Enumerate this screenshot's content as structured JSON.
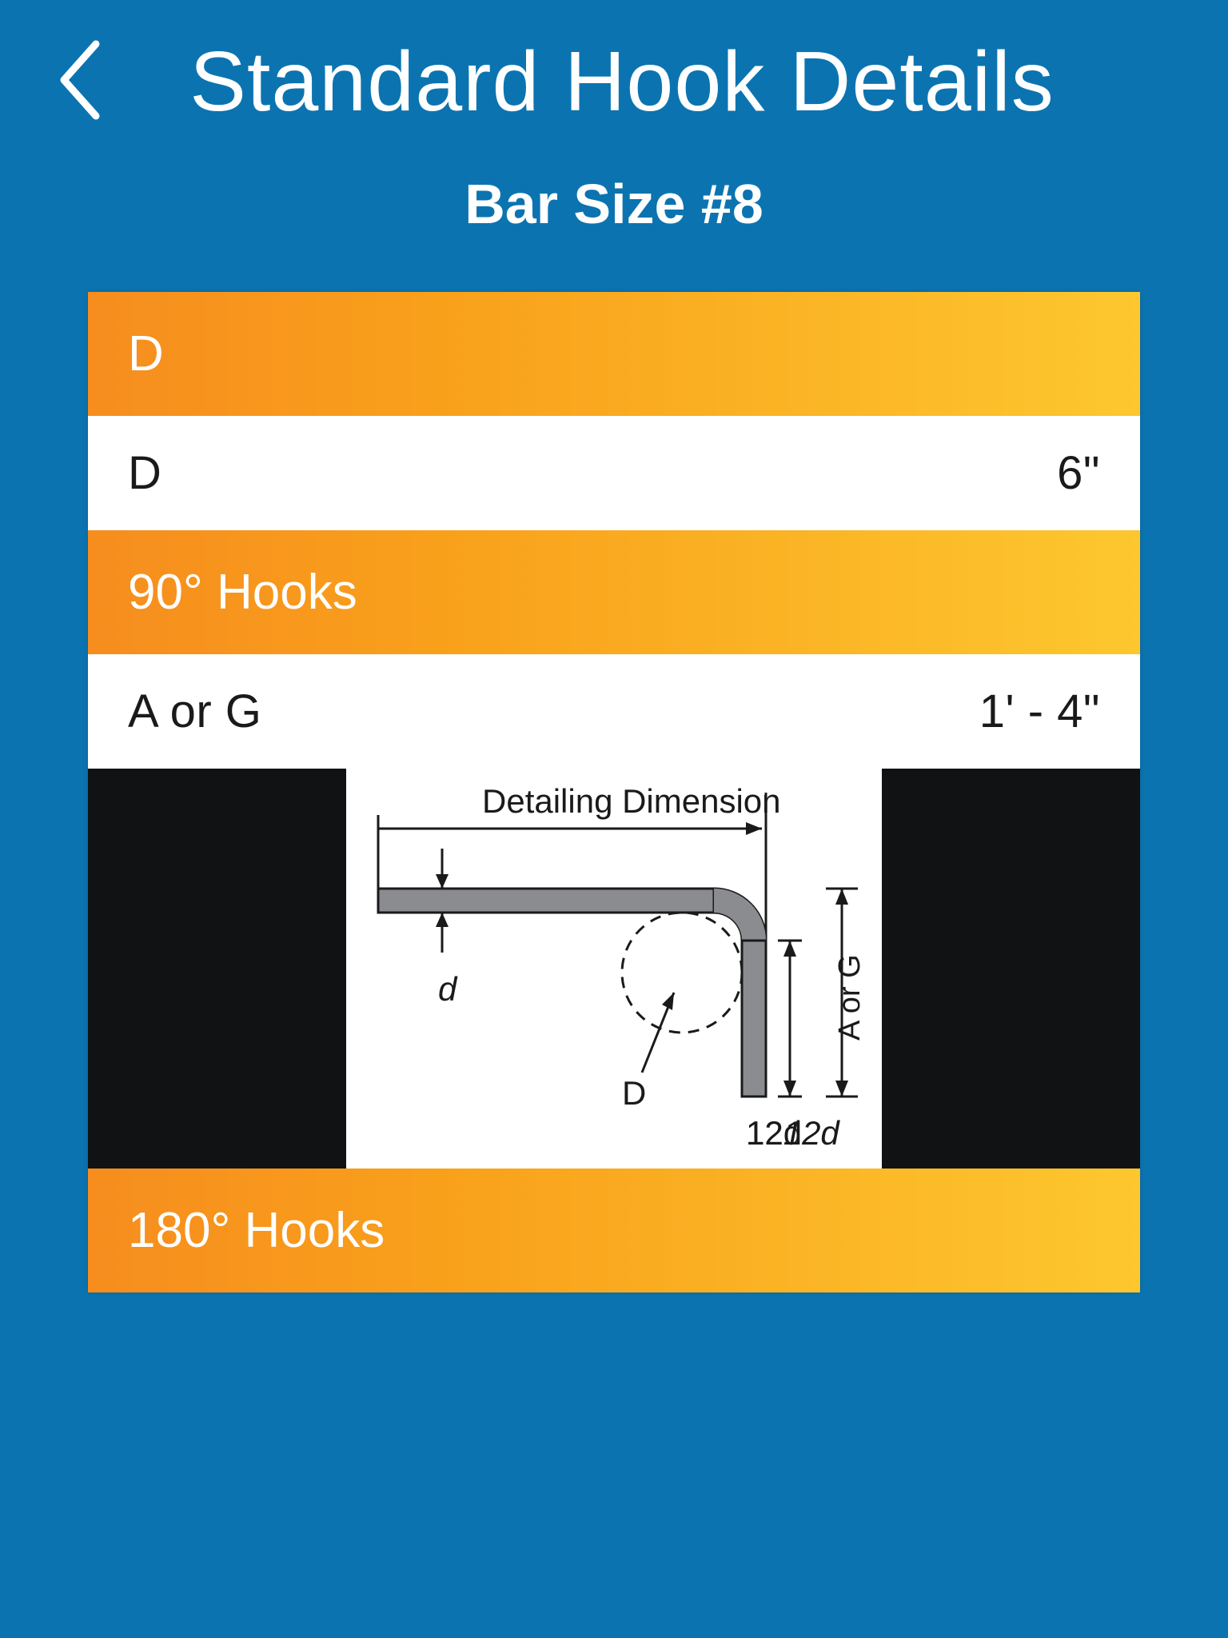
{
  "header": {
    "title": "Standard Hook Details",
    "subtitle": "Bar Size #8"
  },
  "sections": {
    "d_header": "D",
    "d_row_label": "D",
    "d_row_value": "6\"",
    "hooks90_header": "90° Hooks",
    "hooks90_row_label": "A or G",
    "hooks90_row_value": "1' - 4\"",
    "hooks180_header": "180° Hooks"
  },
  "diagram": {
    "title": "Detailing Dimension",
    "d_small": "d",
    "d_big": "D",
    "twelve_d": "12d",
    "a_or_g": "A or G"
  }
}
